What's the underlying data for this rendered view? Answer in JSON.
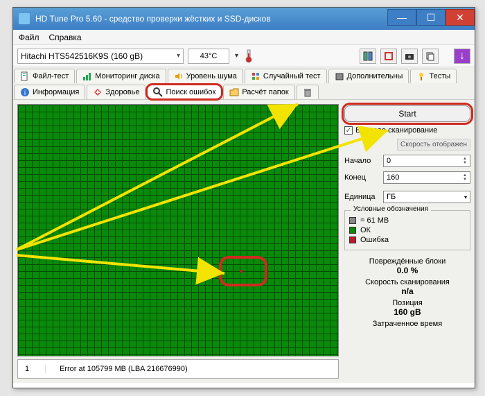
{
  "window": {
    "title": "HD Tune Pro 5.60 - средство проверки жёстких и SSD-дисков"
  },
  "menu": {
    "file": "Файл",
    "help": "Справка"
  },
  "toolbar": {
    "drive": "Hitachi HTS542516K9S (160 gB)",
    "temp": "43°C"
  },
  "tabs": {
    "row1": [
      "Файл-тест",
      "Мониторинг диска",
      "Уровень шума",
      "Случайный тест",
      "Дополнительны"
    ],
    "row2": [
      "Тесты",
      "Информация",
      "Здоровье",
      "Поиск ошибок",
      "Расчёт папок"
    ]
  },
  "scan": {
    "start": "Start",
    "quick_label": "Быстрое сканирование",
    "quick_checked": "✓",
    "speed_disp": "Скорость отображен",
    "start_label": "Начало",
    "start_val": "0",
    "end_label": "Конец",
    "end_val": "160",
    "unit_label": "Единица",
    "unit_val": "ГБ"
  },
  "legend": {
    "title": "Условные обозначения",
    "block": "= 61 MB",
    "ok": "ОК",
    "err": "Ошибка"
  },
  "stats": {
    "damaged_label": "Повреждённые блоки",
    "damaged_val": "0.0 %",
    "speed_label": "Скорость сканирования",
    "speed_val": "n/a",
    "pos_label": "Позиция",
    "pos_val": "160 gB",
    "time_label": "Затраченное время"
  },
  "errtable": {
    "num": "1",
    "text": "Error at 105799 MB (LBA 216676990)"
  }
}
